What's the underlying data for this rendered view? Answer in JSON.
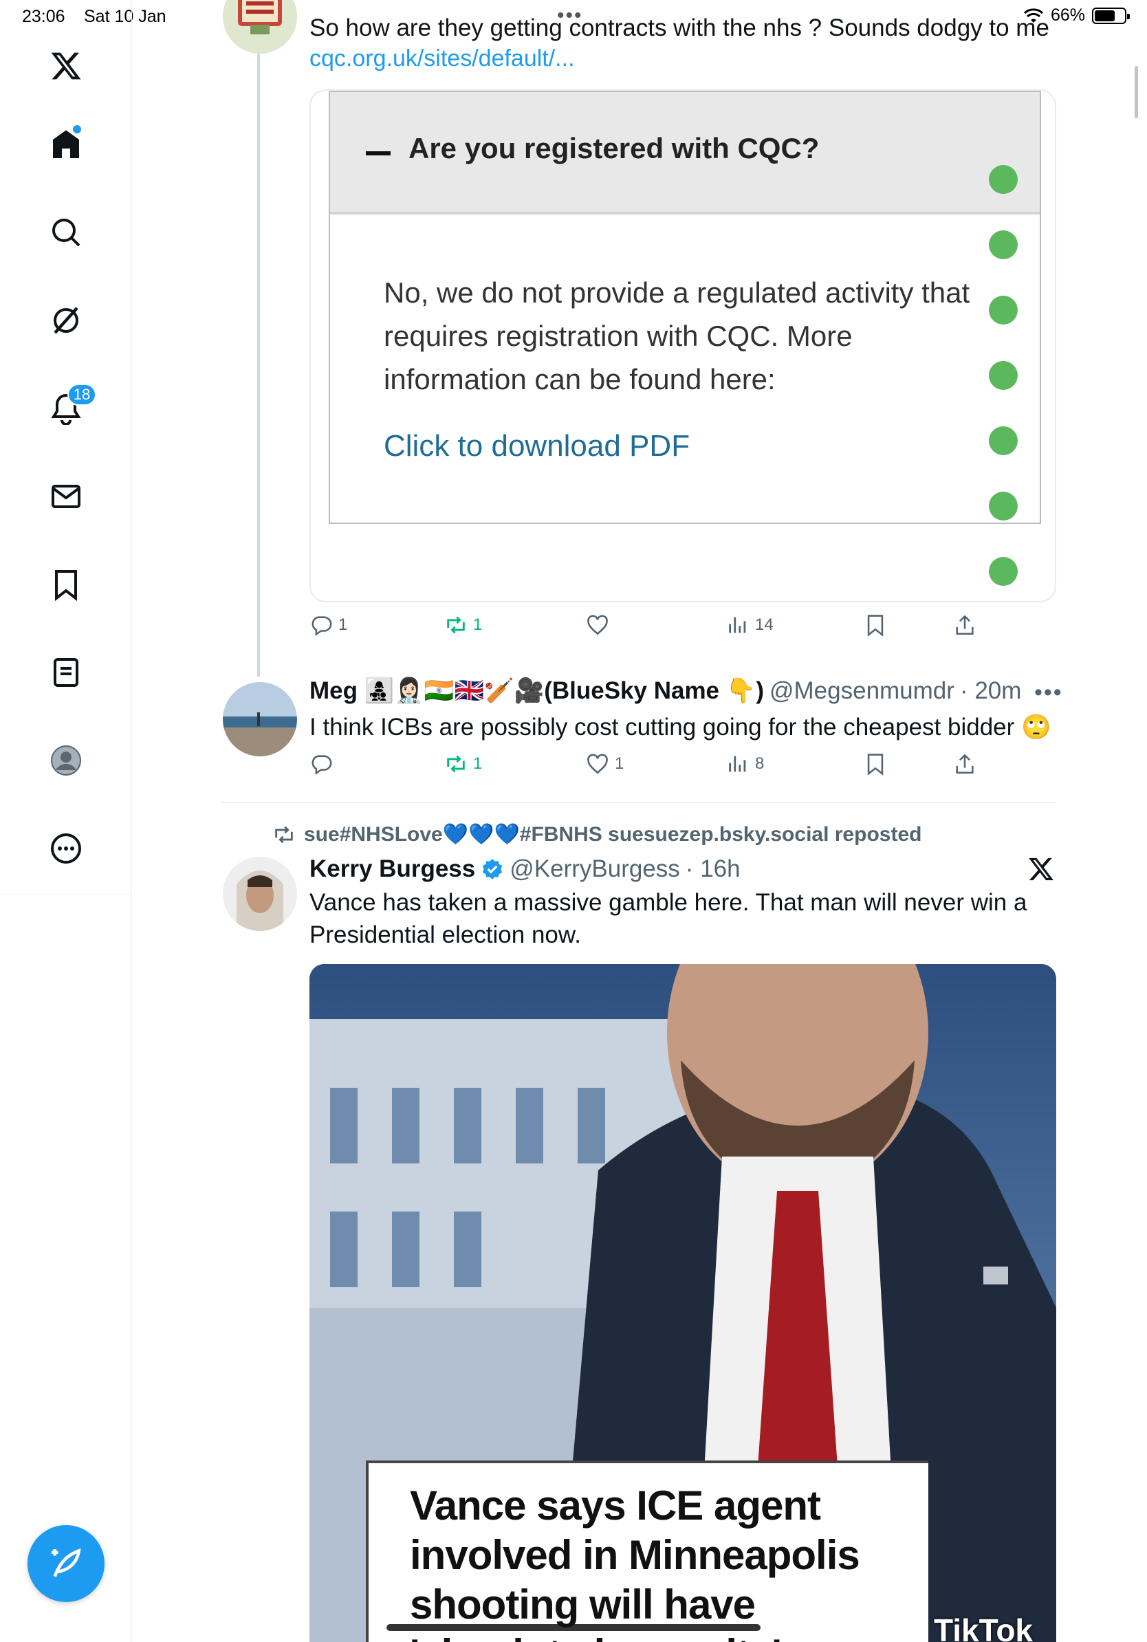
{
  "status_bar": {
    "time": "23:06",
    "date": "Sat 10 Jan",
    "battery": "66%",
    "battery_level": 0.66
  },
  "sidebar": {
    "notifications_badge": "18",
    "items": [
      "home",
      "search",
      "grok",
      "notifications",
      "messages",
      "bookmarks",
      "lists",
      "profile",
      "more"
    ]
  },
  "thread": {
    "top_tweet": {
      "text": "So how are they getting contracts with the nhs ? Sounds dodgy to me",
      "link": "cqc.org.uk/sites/default/...",
      "card": {
        "question": "Are you registered with CQC?",
        "answer": "No, we do not provide a regulated activity that requires registration with CQC. More information can be found here:",
        "download_link": "Click to download PDF"
      },
      "actions": {
        "replies": "1",
        "reposts": "1",
        "likes": "",
        "views": "14"
      }
    },
    "reply_tweet": {
      "name": "Meg 👩‍👧‍👦👩🏻‍⚕️🇮🇳🇬🇧🏏🎥(BlueSky Name 👇)",
      "handle": "@Megsenmumdr",
      "time": "· 20m",
      "text": "I think ICBs are possibly cost cutting going for the cheapest bidder 🙄",
      "actions": {
        "replies": "",
        "reposts": "1",
        "likes": "1",
        "views": "8"
      }
    }
  },
  "repost": {
    "reposted_by": "sue#NHSLove💙💙💙#FBNHS suesuezep.bsky.social reposted",
    "name": "Kerry Burgess",
    "handle": "@KerryBurgess",
    "time": "· 16h",
    "text_line1": "Vance has taken a massive gamble here. That man will never win a",
    "text_line2": "Presidential election now.",
    "video_caption": "Vance says ICE agent involved in Minneapolis shooting will have 'absolute immunity'",
    "video_watermark": "TikTok"
  },
  "colors": {
    "accent": "#1d9bf0",
    "repost_green": "#00ba7c",
    "cqc_green": "#5cb85c"
  }
}
